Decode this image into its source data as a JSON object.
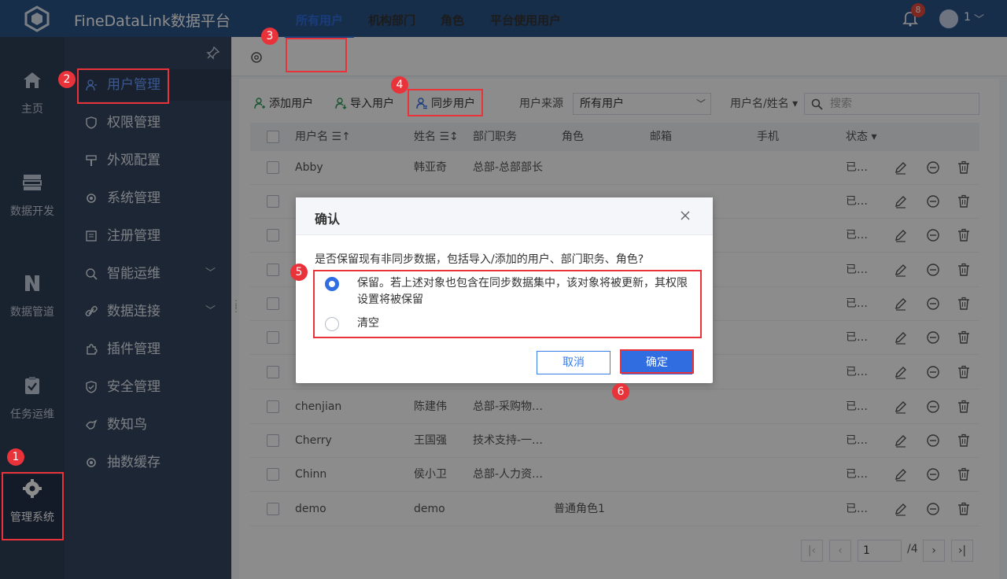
{
  "app": {
    "title": "FineDataLink数据平台",
    "notifications": "8",
    "user": "1"
  },
  "leftnav": [
    {
      "label": "主页",
      "icon": "home-icon"
    },
    {
      "label": "数据开发",
      "icon": "data-dev-icon"
    },
    {
      "label": "数据管道",
      "icon": "pipeline-icon"
    },
    {
      "label": "任务运维",
      "icon": "task-ops-icon"
    },
    {
      "label": "管理系统",
      "icon": "admin-gear-icon"
    }
  ],
  "menu": [
    {
      "label": "用户管理",
      "icon": "user-manage-icon"
    },
    {
      "label": "权限管理",
      "icon": "shield-icon"
    },
    {
      "label": "外观配置",
      "icon": "brush-icon"
    },
    {
      "label": "系统管理",
      "icon": "gear-icon"
    },
    {
      "label": "注册管理",
      "icon": "register-icon"
    },
    {
      "label": "智能运维",
      "icon": "smart-ops-icon"
    },
    {
      "label": "数据连接",
      "icon": "link-icon"
    },
    {
      "label": "插件管理",
      "icon": "plugin-icon"
    },
    {
      "label": "安全管理",
      "icon": "security-icon"
    },
    {
      "label": "数知鸟",
      "icon": "bird-icon"
    },
    {
      "label": "抽数缓存",
      "icon": "cache-icon"
    }
  ],
  "tabs": [
    "所有用户",
    "机构部门",
    "角色",
    "平台使用用户"
  ],
  "toolbar": {
    "add": "添加用户",
    "import": "导入用户",
    "sync": "同步用户",
    "source_label": "用户来源",
    "source_value": "所有用户",
    "filter_label": "用户名/姓名",
    "search_placeholder": "搜索"
  },
  "table": {
    "headers": [
      "用户名",
      "姓名",
      "部门职务",
      "角色",
      "邮箱",
      "手机",
      "状态"
    ],
    "rows": [
      {
        "username": "Abby",
        "name": "韩亚奇",
        "dept": "总部-总部部长",
        "role": "",
        "status": "已…"
      },
      {
        "username": "",
        "name": "",
        "dept": "",
        "role": "",
        "status": "已…"
      },
      {
        "username": "",
        "name": "",
        "dept": "",
        "role": "",
        "status": "已…"
      },
      {
        "username": "",
        "name": "",
        "dept": "",
        "role": "",
        "status": "已…"
      },
      {
        "username": "",
        "name": "",
        "dept": "",
        "role": "",
        "status": "已…"
      },
      {
        "username": "",
        "name": "",
        "dept": "",
        "role": "",
        "status": "已…"
      },
      {
        "username": "",
        "name": "",
        "dept": "",
        "role": "",
        "status": "已…"
      },
      {
        "username": "chenjian",
        "name": "陈建伟",
        "dept": "总部-采购物…",
        "role": "",
        "status": "已…"
      },
      {
        "username": "Cherry",
        "name": "王国强",
        "dept": "技术支持-一…",
        "role": "",
        "status": "已…"
      },
      {
        "username": "Chinn",
        "name": "侯小卫",
        "dept": "总部-人力资…",
        "role": "",
        "status": "已…"
      },
      {
        "username": "demo",
        "name": "demo",
        "dept": "",
        "role": "普通角色1",
        "status": "已…"
      }
    ]
  },
  "pager": {
    "page": "1",
    "total": "/4"
  },
  "dialog": {
    "title": "确认",
    "message": "是否保留现有非同步数据，包括导入/添加的用户、部门职务、角色?",
    "option_keep_line1": "保留。若上述对象也包含在同步数据集中，该对象将被更新，其权限",
    "option_keep_line2": "设置将被保留",
    "option_clear": "清空",
    "cancel": "取消",
    "ok": "确定"
  },
  "annotations": [
    "1",
    "2",
    "3",
    "4",
    "5",
    "6"
  ],
  "colors": {
    "topbar": "#2b5489",
    "accent": "#2f6de1",
    "highlight": "#e8333b"
  }
}
